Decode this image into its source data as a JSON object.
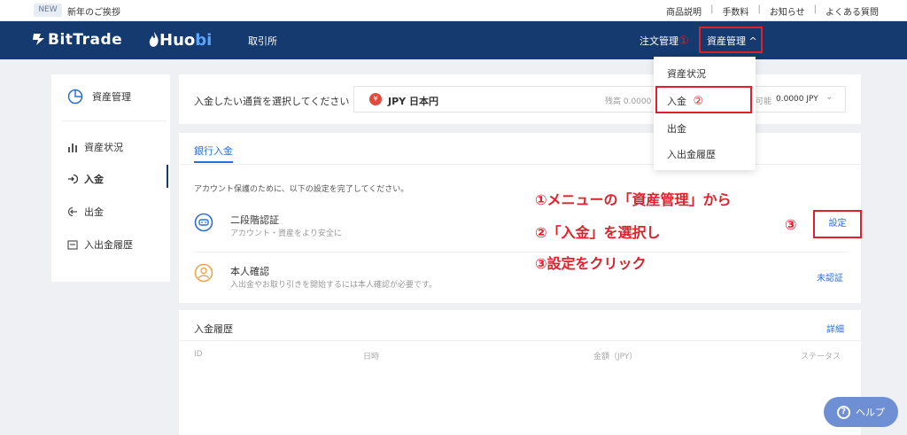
{
  "topbar": {
    "badge": "NEW",
    "notice": "新年のご挨拶",
    "links": [
      "商品説明",
      "手数料",
      "お知らせ",
      "よくある質問"
    ],
    "separator": "|"
  },
  "header": {
    "logo_bittrade": "BitTrade",
    "logo_huobi_hu": "Huo",
    "logo_huobi_bi": "bi",
    "nav_trade": "取引所",
    "nav_orders": "注文管理",
    "nav_orders_marker": "①",
    "nav_assets": "資産管理",
    "nav_assets_chevron": "^"
  },
  "dropdown": {
    "items": [
      "資産状況",
      "入金",
      "出金",
      "入出金履歴"
    ],
    "marker": "②"
  },
  "sidebar": {
    "title": "資産管理",
    "items": [
      {
        "label": "資産状況",
        "icon": "bar-chart-icon"
      },
      {
        "label": "入金",
        "icon": "deposit-icon"
      },
      {
        "label": "出金",
        "icon": "withdraw-icon"
      },
      {
        "label": "入出金履歴",
        "icon": "history-icon"
      }
    ]
  },
  "currency_select": {
    "label": "入金したい通貨を選択してください",
    "coin_symbol": "¥",
    "currency": "JPY  日本円",
    "balance_label": "残高 0.0000",
    "available_label": "可能",
    "available_value": "0.0000 JPY",
    "chevron": "⌄"
  },
  "deposit": {
    "tab": "銀行入金",
    "notice": "アカウント保護のために、以下の設定を完了してください。",
    "two_factor_title": "二段階認証",
    "two_factor_sub": "アカウント・資産をより安全に",
    "settings_button": "設定",
    "settings_marker": "③",
    "identity_title": "本人確認",
    "identity_sub": "入出金やお取り引きを開始するには本人確認が必要です。",
    "identity_status": "未認証"
  },
  "annotations": [
    "①メニューの「資産管理」から",
    "②「入金」を選択し",
    "③設定をクリック"
  ],
  "history": {
    "title": "入金履歴",
    "detail": "詳細",
    "columns": [
      "ID",
      "日時",
      "金額（JPY）",
      "ステータス"
    ]
  },
  "help": {
    "label": "ヘルプ",
    "icon": "?"
  },
  "colors": {
    "header_bg": "#153a6f",
    "accent_blue": "#2b6fd6",
    "annotation_red": "#e0202a"
  }
}
